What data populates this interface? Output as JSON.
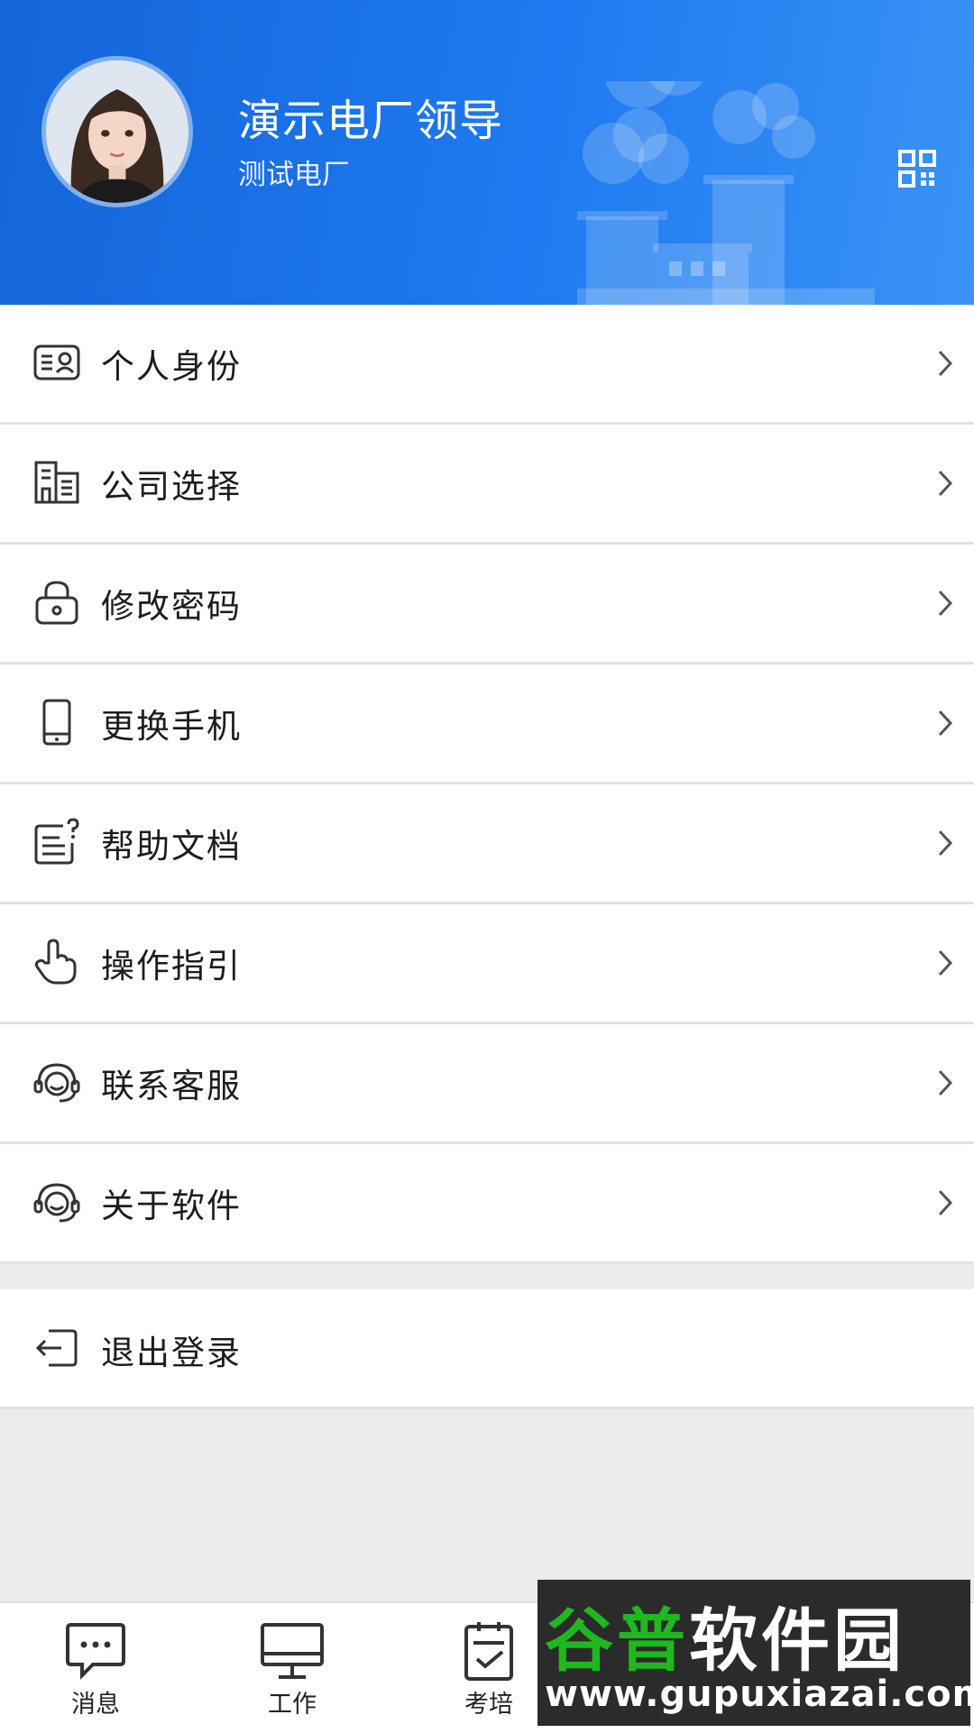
{
  "profile": {
    "name": "演示电厂领导",
    "organization": "测试电厂",
    "qr_icon": "qr-code-icon"
  },
  "menu": [
    {
      "label": "个人身份",
      "icon": "id-card-icon"
    },
    {
      "label": "公司选择",
      "icon": "building-icon"
    },
    {
      "label": "修改密码",
      "icon": "lock-icon"
    },
    {
      "label": "更换手机",
      "icon": "phone-icon"
    },
    {
      "label": "帮助文档",
      "icon": "help-document-icon"
    },
    {
      "label": "操作指引",
      "icon": "pointer-hand-icon"
    },
    {
      "label": "联系客服",
      "icon": "headset-icon"
    },
    {
      "label": "关于软件",
      "icon": "headset-icon"
    }
  ],
  "logout": {
    "label": "退出登录",
    "icon": "logout-icon"
  },
  "tabbar": [
    {
      "label": "消息",
      "icon": "chat-bubble-icon"
    },
    {
      "label": "工作",
      "icon": "monitor-icon"
    },
    {
      "label": "考培",
      "icon": "clipboard-check-icon"
    }
  ],
  "watermark": {
    "title_green": "谷普",
    "title_white": "软件园",
    "url": "www.gupuxiazai.com"
  },
  "colors": {
    "header_blue": "#1e7af0",
    "background": "#ececed",
    "watermark_green": "#1fb81f"
  }
}
